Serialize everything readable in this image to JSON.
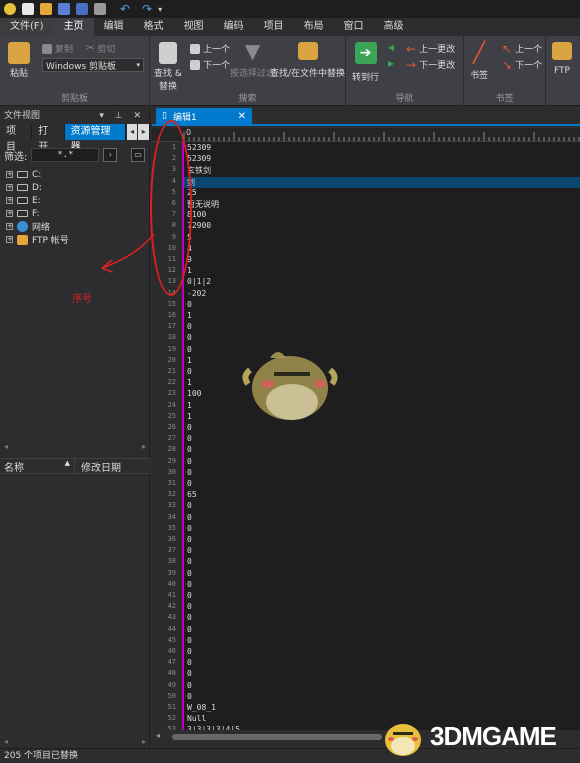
{
  "menu": [
    "文件(F)",
    "主页",
    "编辑",
    "格式",
    "视图",
    "编码",
    "项目",
    "布局",
    "窗口",
    "高级"
  ],
  "ribbon": {
    "clipboard": {
      "paste": "粘贴",
      "copy": "复制",
      "cut": "剪切",
      "clipboard_select": "Windows 剪贴板",
      "label": "剪贴板"
    },
    "search": {
      "find_replace": "查找 &\n替换",
      "prev": "上一个",
      "next": "下一个",
      "filter": "按选择过滤",
      "find_in_files": "查找/在文件中替换",
      "label": "搜索"
    },
    "navigate": {
      "goto_line": "转到行",
      "prev_change": "上一更改",
      "next_change": "下一更改",
      "label": "导航"
    },
    "bookmarks": {
      "bookmark": "书签",
      "prev": "上一个",
      "next": "下一个",
      "label": "书签"
    },
    "ftp": {
      "label": "FTP"
    }
  },
  "left_panel": {
    "title": "文件视图",
    "tabs": [
      "项目",
      "打开",
      "资源管理器"
    ],
    "filter_label": "筛选:",
    "filter_value": "*.*",
    "tree": [
      "C:",
      "D:",
      "E:",
      "F:",
      "网络",
      "FTP 帐号"
    ],
    "columns": {
      "name": "名称",
      "modified": "修改日期"
    }
  },
  "editor": {
    "tab_title": "编辑1",
    "ruler_start": "0",
    "lines": [
      "52309",
      "52309",
      "玄铁剑",
      "剑",
      "25",
      "暂无说明",
      "8100",
      "72900",
      "5",
      "4",
      "9",
      "1",
      "0|1|2",
      "-202",
      "0",
      "1",
      "0",
      "0",
      "0",
      "1",
      "0",
      "1",
      "100",
      "1",
      "1",
      "0",
      "0",
      "0",
      "0",
      "0",
      "0",
      "65",
      "0",
      "0",
      "0",
      "0",
      "0",
      "0",
      "0",
      "0",
      "0",
      "0",
      "0",
      "0",
      "0",
      "0",
      "0",
      "0",
      "0",
      "0",
      "W_08_1",
      "Null",
      "3|3|3|3|4|5"
    ],
    "current_line": 4
  },
  "annotation": {
    "label": "序号"
  },
  "status": {
    "text": "205 个项目已替换"
  },
  "watermark": {
    "text": "3DMGAME"
  },
  "colors": {
    "accent": "#007acc",
    "annotation": "#e02020",
    "margin_line": "#c000c0"
  }
}
